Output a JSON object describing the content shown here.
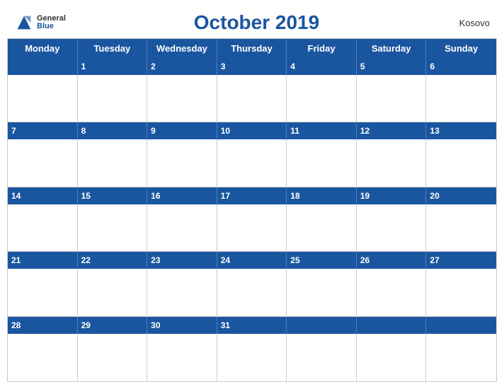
{
  "logo": {
    "general": "General",
    "blue": "Blue",
    "icon_color": "#1a56a0"
  },
  "header": {
    "title": "October 2019",
    "country": "Kosovo"
  },
  "days": {
    "headers": [
      "Monday",
      "Tuesday",
      "Wednesday",
      "Thursday",
      "Friday",
      "Saturday",
      "Sunday"
    ]
  },
  "weeks": [
    {
      "band": [
        "",
        "1",
        "2",
        "3",
        "4",
        "5",
        "6"
      ]
    },
    {
      "band": [
        "7",
        "8",
        "9",
        "10",
        "11",
        "12",
        "13"
      ]
    },
    {
      "band": [
        "14",
        "15",
        "16",
        "17",
        "18",
        "19",
        "20"
      ]
    },
    {
      "band": [
        "21",
        "22",
        "23",
        "24",
        "25",
        "26",
        "27"
      ]
    },
    {
      "band": [
        "28",
        "29",
        "30",
        "31",
        "",
        "",
        ""
      ]
    }
  ],
  "colors": {
    "blue": "#1a56a0",
    "header_bg": "#1a56a0",
    "border": "#cccccc",
    "white": "#ffffff"
  }
}
